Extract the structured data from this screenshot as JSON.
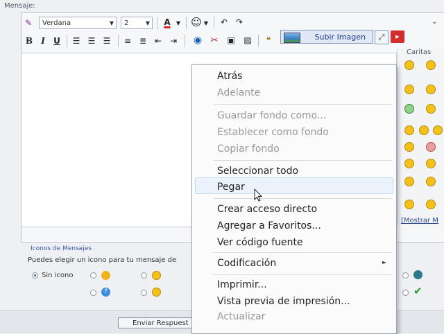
{
  "editor": {
    "label": "Mensaje:",
    "font_combo": "Verdana",
    "size_combo": "2",
    "toolbar": {
      "bold": "B",
      "italic": "I",
      "underline": "U",
      "font_color": "A"
    },
    "upload_button": "Subir Imagen"
  },
  "caritas": {
    "title": "Caritas",
    "more_link": "[Mostrar M"
  },
  "message_icons": {
    "title": "Iconos de Mensajes",
    "description": "Puedes elegir un icono para tu mensaje de",
    "none_label": "Sin icono"
  },
  "submit": {
    "label": "Enviar Respuest"
  },
  "context_menu": {
    "items": [
      {
        "label": "Atrás",
        "enabled": true
      },
      {
        "label": "Adelante",
        "enabled": false
      },
      {
        "label": "Guardar fondo como...",
        "enabled": false
      },
      {
        "label": "Establecer como fondo",
        "enabled": false
      },
      {
        "label": "Copiar fondo",
        "enabled": false
      },
      {
        "label": "Seleccionar todo",
        "enabled": true
      },
      {
        "label": "Pegar",
        "enabled": true,
        "highlighted": true
      },
      {
        "label": "Crear acceso directo",
        "enabled": true
      },
      {
        "label": "Agregar a Favoritos...",
        "enabled": true
      },
      {
        "label": "Ver código fuente",
        "enabled": true
      },
      {
        "label": "Codificación",
        "enabled": true,
        "has_submenu": true
      },
      {
        "label": "Imprimir...",
        "enabled": true
      },
      {
        "label": "Vista previa de impresión...",
        "enabled": true
      },
      {
        "label": "Actualizar",
        "enabled": false
      }
    ]
  },
  "colors": {
    "highlight": "#eaf2fb",
    "link": "#3b56a6",
    "smiley": "#f2c21b"
  }
}
